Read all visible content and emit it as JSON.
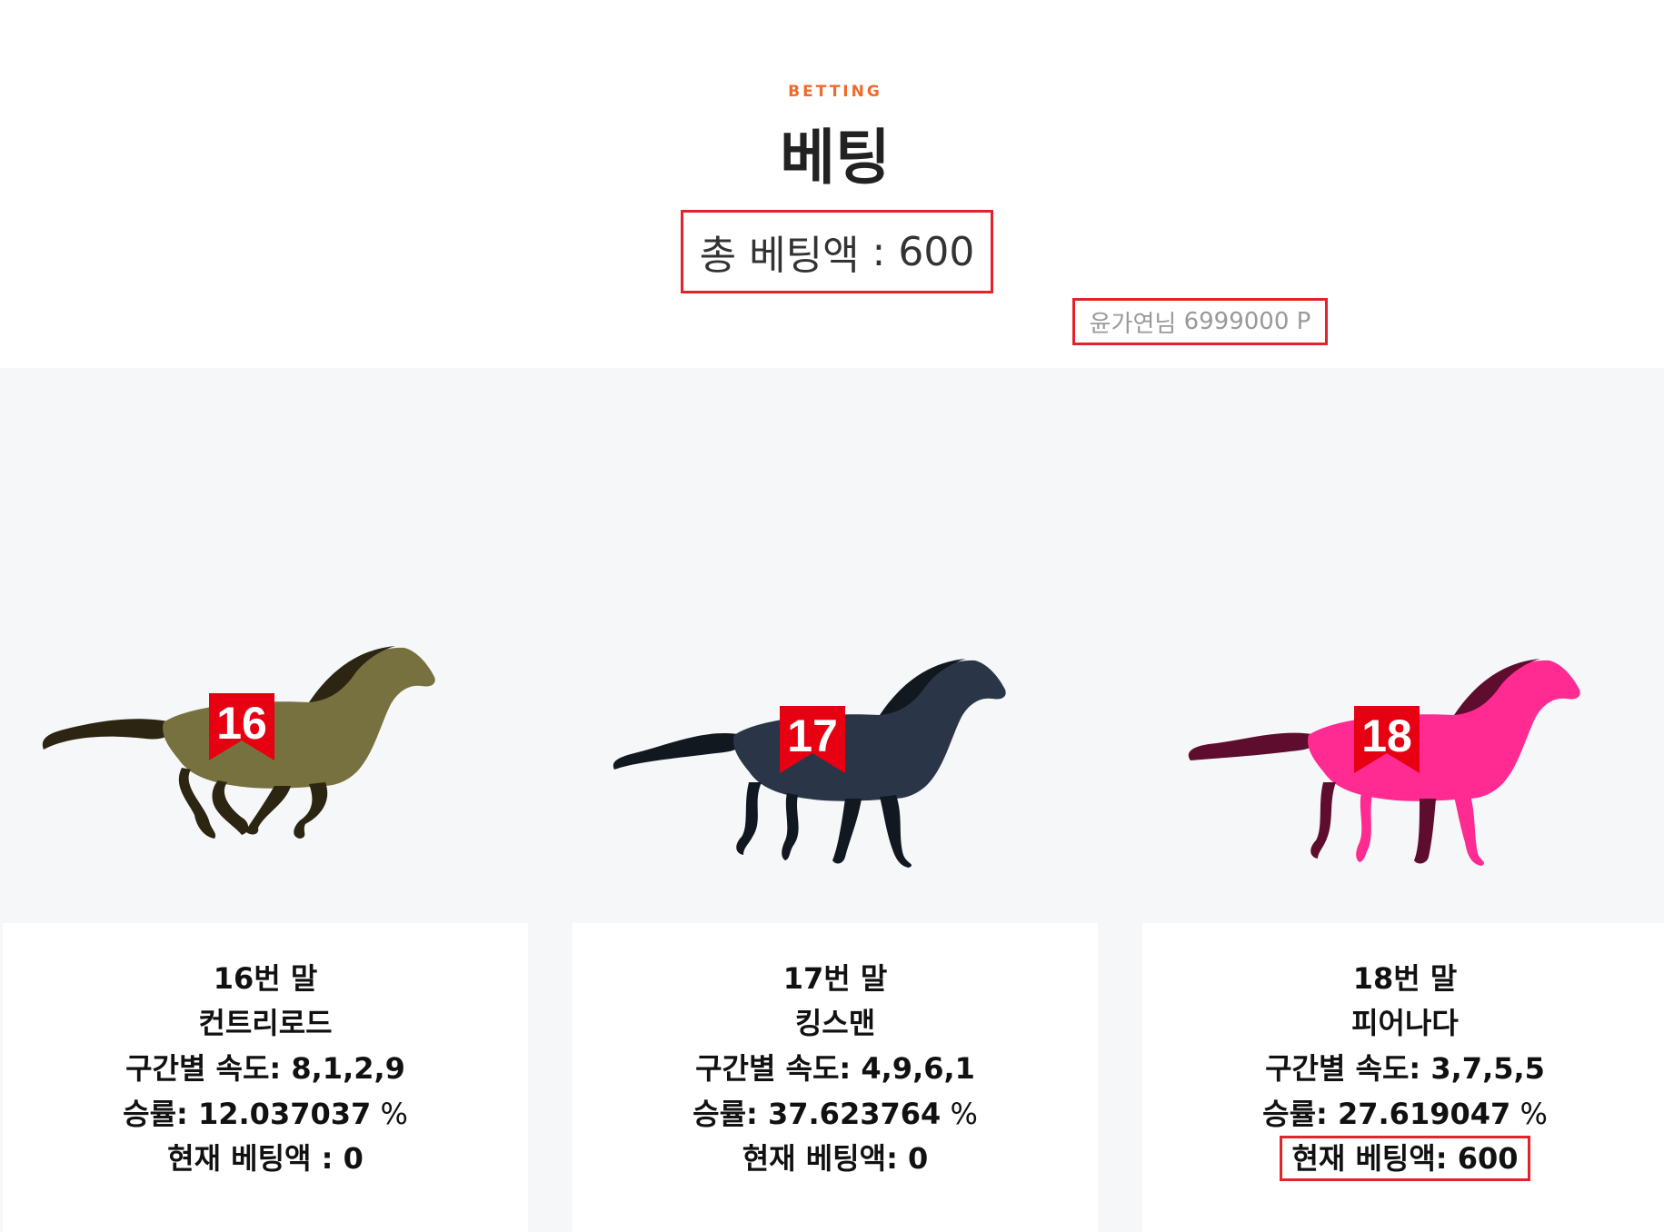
{
  "header": {
    "eyebrow": "BETTING",
    "title": "베팅",
    "total_label": "총 베팅액",
    "total_sep": " : ",
    "total_value": "600",
    "user_name": "윤가연님",
    "user_points": "6999000",
    "points_unit": "P"
  },
  "horses": [
    {
      "number": "16",
      "number_line": "16번 말",
      "name": "컨트리로드",
      "speed_label": "구간별 속도:",
      "speed": "8,1,2,9",
      "winrate_label": "승률:",
      "winrate": "12.037037",
      "unit": "%",
      "bet_label": "현재 베팅액",
      "bet_sep": " : ",
      "bet": "0",
      "body_color": "#77703f",
      "dark_color": "#2b2512"
    },
    {
      "number": "17",
      "number_line": "17번 말",
      "name": "킹스맨",
      "speed_label": "구간별 속도:",
      "speed": "4,9,6,1",
      "winrate_label": "승률:",
      "winrate": "37.623764",
      "unit": "%",
      "bet_label": "현재 베팅액",
      "bet_sep": ": ",
      "bet": "0",
      "body_color": "#2a3648",
      "dark_color": "#121820"
    },
    {
      "number": "18",
      "number_line": "18번 말",
      "name": "피어나다",
      "speed_label": "구간별 속도:",
      "speed": "3,7,5,5",
      "winrate_label": "승률:",
      "winrate": "27.619047",
      "unit": "%",
      "bet_label": "현재 베팅액",
      "bet_sep": ": ",
      "bet": "600",
      "body_color": "#ff2a92",
      "dark_color": "#5e0d2e"
    }
  ],
  "colors": {
    "accent": "#f06a2a",
    "highlight_border": "#e2232a",
    "saddle": "#e60012"
  }
}
